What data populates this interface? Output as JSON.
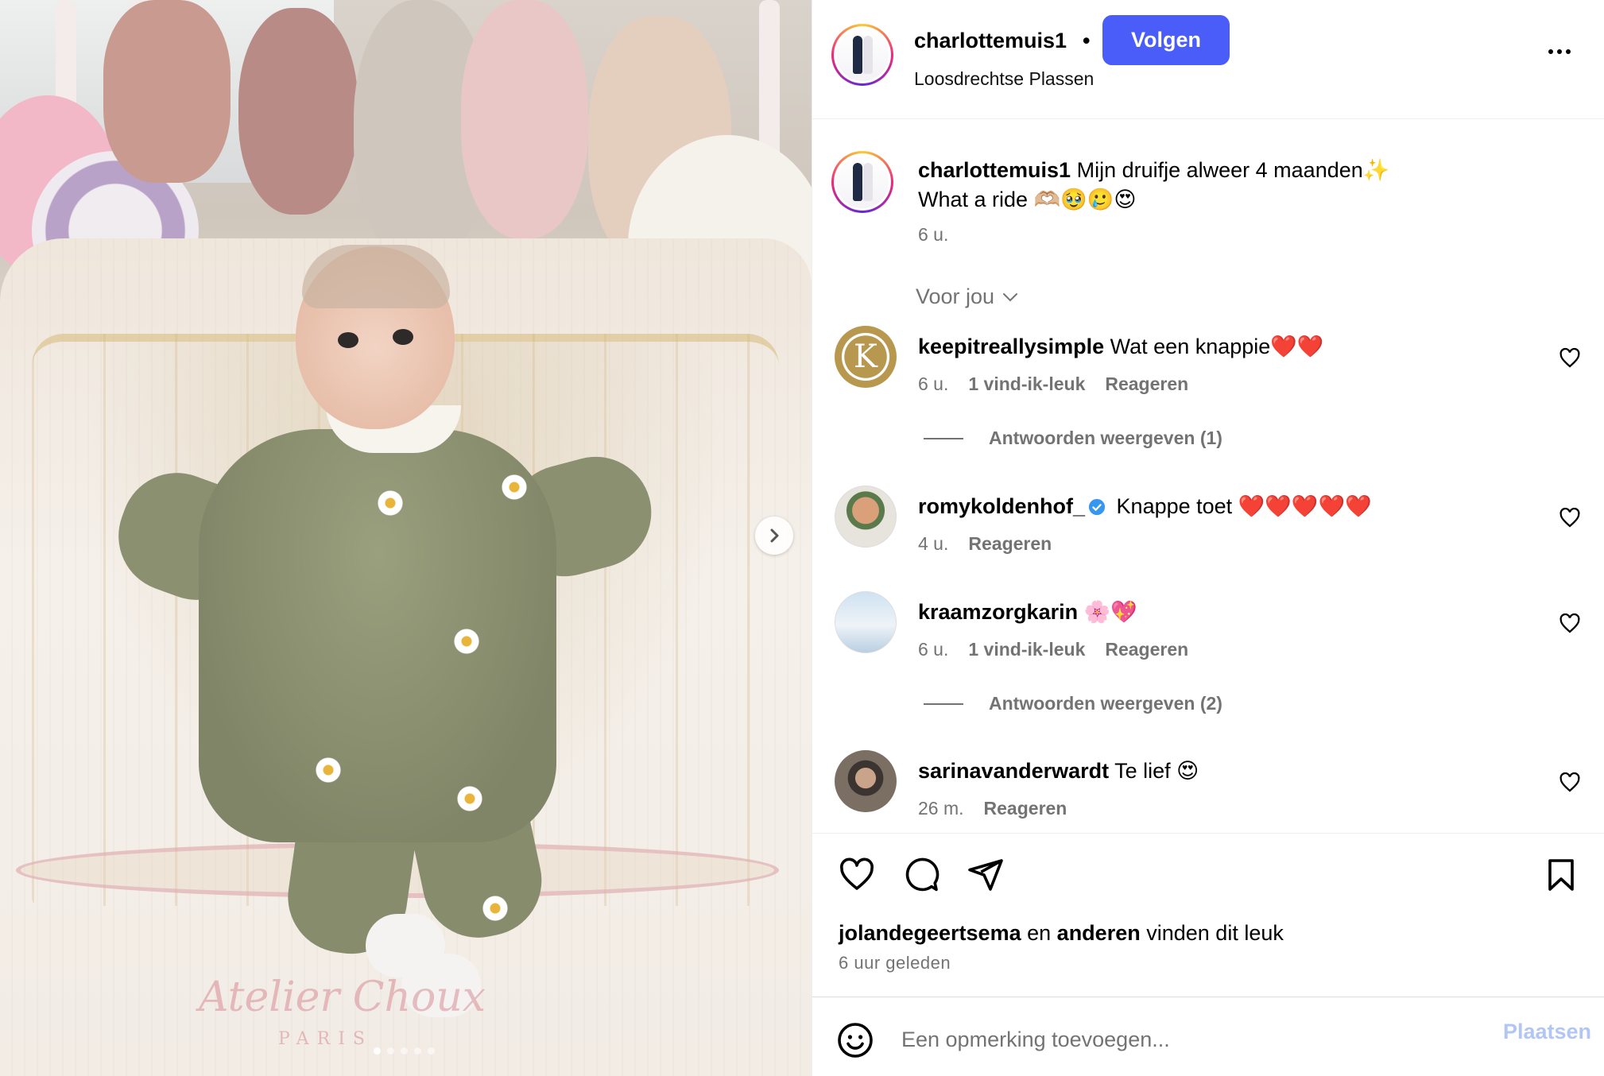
{
  "post": {
    "owner": "charlottemuis1",
    "separator": "•",
    "follow_label": "Volgen",
    "location": "Loosdrechtse Plassen",
    "media_watermark": "Atelier Choux",
    "media_watermark_sub": "PARIS",
    "carousel": {
      "total": 5,
      "current": 1
    }
  },
  "caption": {
    "username": "charlottemuis1",
    "line1": "Mijn druifje alweer 4 maanden✨",
    "line2": "What a ride 🫶🏼🥹🥲😍",
    "time": "6 u."
  },
  "sort_label": "Voor jou",
  "comments": [
    {
      "username": "keepitreallysimple",
      "text": "Wat een knappie❤️❤️",
      "time": "6 u.",
      "likes": "1 vind-ik-leuk",
      "reply": "Reageren",
      "replies": "Antwoorden weergeven (1)",
      "avatar_letter": "K"
    },
    {
      "username": "romykoldenhof_",
      "text": "Knappe toet ❤️❤️❤️❤️❤️",
      "time": "4 u.",
      "reply": "Reageren",
      "verified": true
    },
    {
      "username": "kraamzorgkarin",
      "text": "🌸💖",
      "time": "6 u.",
      "likes": "1 vind-ik-leuk",
      "reply": "Reageren",
      "replies": "Antwoorden weergeven (2)"
    },
    {
      "username": "sarinavanderwardt",
      "text": "Te lief 😍",
      "time": "26 m.",
      "reply": "Reageren"
    }
  ],
  "likes_summary": {
    "user": "jolandegeertsema",
    "and": "en",
    "others": "anderen",
    "suffix": "vinden dit leuk"
  },
  "post_time": "6 uur geleden",
  "add_comment": {
    "placeholder": "Een opmerking toevoegen...",
    "post_label": "Plaatsen"
  },
  "colors": {
    "follow_button": "#4a5df9",
    "muted_text": "#737373",
    "post_button_disabled": "#b2c6f5",
    "verified_badge": "#3797f0"
  },
  "icons": [
    "next-chevron-icon",
    "more-icon",
    "heart-icon",
    "comment-icon",
    "share-icon",
    "bookmark-icon",
    "emoji-icon",
    "chevron-down-icon",
    "verified-icon"
  ]
}
